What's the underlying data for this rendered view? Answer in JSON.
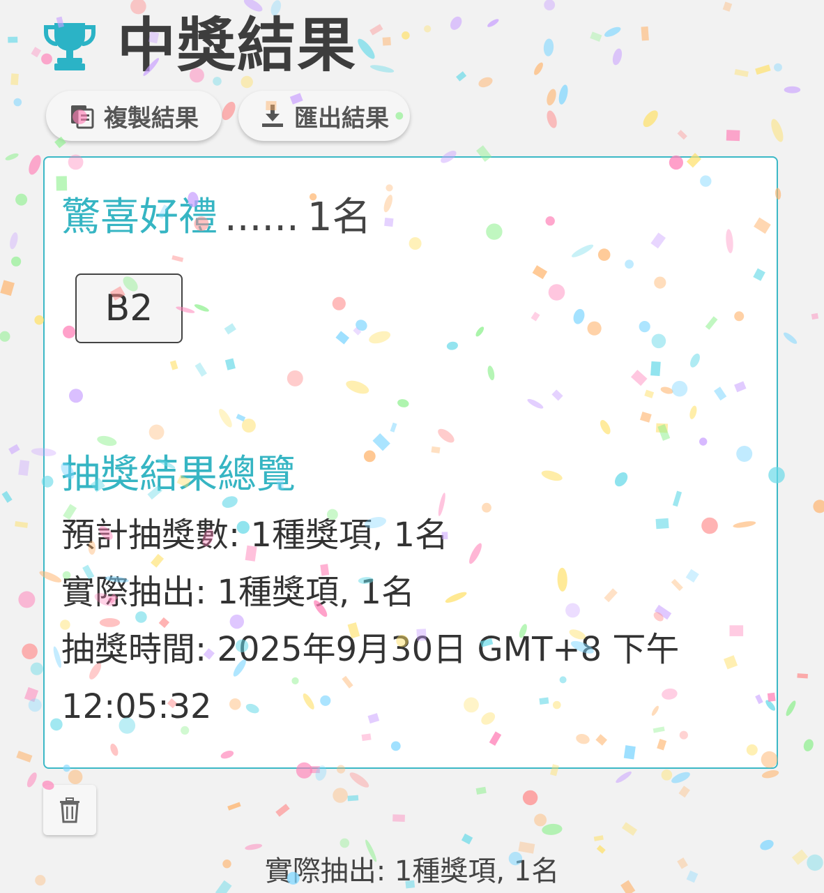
{
  "header": {
    "icon": "trophy-icon",
    "title": "中獎結果"
  },
  "actions": {
    "copy_label": "複製結果",
    "copy_icon": "copy-icon",
    "export_label": "匯出結果",
    "export_icon": "download-icon"
  },
  "result_card": {
    "prize_name": "驚喜好禮",
    "separator": "......",
    "prize_count": "1名",
    "winners": [
      "B2"
    ]
  },
  "summary": {
    "title": "抽獎結果總覽",
    "planned": "預計抽獎數: 1種獎項, 1名",
    "actual": "實際抽出: 1種獎項, 1名",
    "time_line1": "抽獎時間: 2025年9月30日 GMT+8 下午",
    "time_line2": "12:05:32"
  },
  "delete": {
    "icon": "trash-icon"
  },
  "footer": {
    "status": "實際抽出: 1種獎項, 1名"
  },
  "colors": {
    "accent": "#36b5c3",
    "border": "#3bb8c6",
    "background": "#f2f2f2",
    "text": "#3a3a3a"
  }
}
